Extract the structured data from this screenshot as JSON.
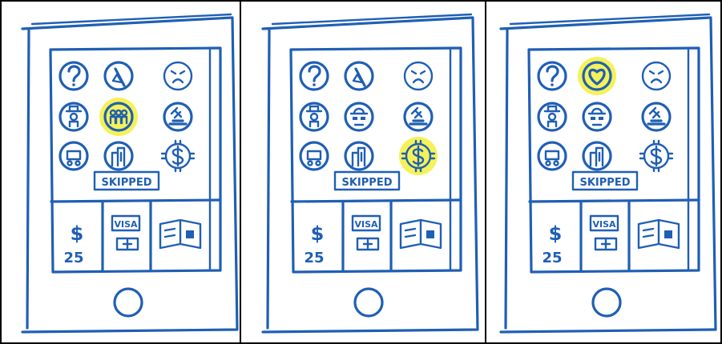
{
  "frames": [
    {
      "id": "sketch-1",
      "highlighted_icon": "group-icon",
      "icons": [
        "question-icon",
        "no-sound-icon",
        "angry-face-icon",
        "cowboy-icon",
        "group-icon",
        "gavel-icon",
        "stroller-icon",
        "buildings-icon",
        "money-icon"
      ],
      "skipped_label": "SKIPPED",
      "amount_symbol": "$",
      "amount_value": "25",
      "card_label": "VISA"
    },
    {
      "id": "sketch-2",
      "highlighted_icon": "money-icon",
      "icons": [
        "question-icon",
        "no-sound-icon",
        "angry-face-icon",
        "cowboy-icon",
        "spy-icon",
        "gavel-icon",
        "stroller-icon",
        "buildings-icon",
        "money-icon"
      ],
      "skipped_label": "SKIPPED",
      "amount_symbol": "$",
      "amount_value": "25",
      "card_label": "VISA"
    },
    {
      "id": "sketch-3",
      "highlighted_icon": "heart-icon",
      "icons": [
        "question-icon",
        "heart-icon",
        "angry-face-icon",
        "cowboy-icon",
        "spy-icon",
        "gavel-icon",
        "stroller-icon",
        "buildings-icon",
        "money-icon"
      ],
      "skipped_label": "SKIPPED",
      "amount_symbol": "$",
      "amount_value": "25",
      "card_label": "VISA"
    }
  ],
  "colors": {
    "ink": "#1f5fb4",
    "highlight": "#f3ee3c",
    "frame_border": "#000000"
  }
}
